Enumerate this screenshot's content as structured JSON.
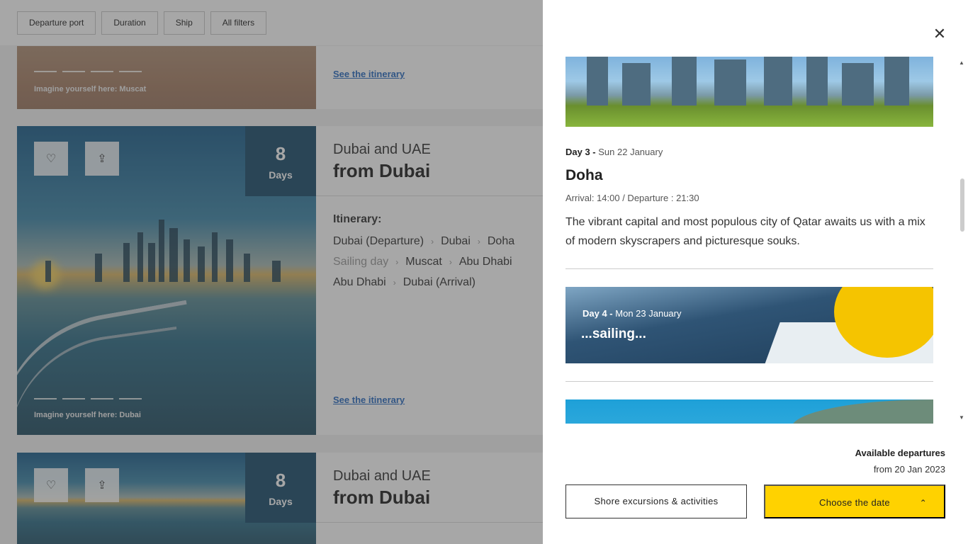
{
  "filters": [
    "Departure port",
    "Duration",
    "Ship",
    "All filters"
  ],
  "card_top": {
    "imagine": "Imagine yourself here: Muscat",
    "see": "See the itinerary"
  },
  "card_main": {
    "days_num": "8",
    "days_label": "Days",
    "title_line1": "Dubai and UAE",
    "title_line2": "from Dubai",
    "itinerary_label": "Itinerary:",
    "row1": [
      "Dubai (Departure)",
      "Dubai",
      "Doha"
    ],
    "row2": [
      "Sailing day",
      "Muscat",
      "Abu Dhabi"
    ],
    "row3": [
      "Abu Dhabi",
      "Dubai (Arrival)"
    ],
    "imagine": "Imagine yourself here: Dubai",
    "see": "See the itinerary"
  },
  "card_bottom": {
    "days_num": "8",
    "days_label": "Days",
    "title_line1": "Dubai and UAE",
    "title_line2": "from Dubai"
  },
  "panel": {
    "day3_prefix": "Day 3 -",
    "day3_date": "Sun 22 January",
    "city": "Doha",
    "arrival": "Arrival: 14:00 / Departure : 21:30",
    "description": "The vibrant capital and most populous city of Qatar awaits us with a mix of modern skyscrapers and picturesque souks.",
    "day4_prefix": "Day 4 -",
    "day4_date": "Mon 23 January",
    "sailing": "...sailing...",
    "available_departures": "Available departures",
    "from_date": "from 20 Jan 2023",
    "shore_button": "Shore excursions & activities",
    "date_button": "Choose the date"
  }
}
